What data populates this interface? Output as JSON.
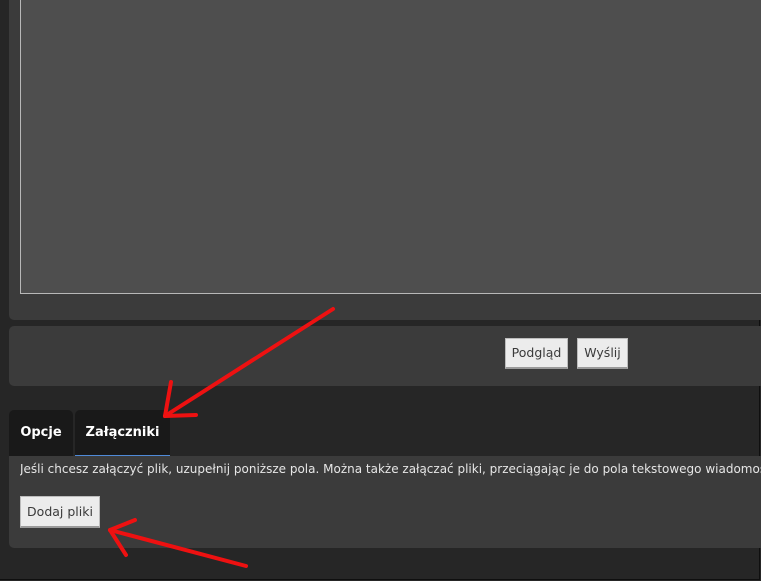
{
  "editor": {
    "message_value": ""
  },
  "submit_bar": {
    "preview_label": "Podgląd",
    "submit_label": "Wyślij"
  },
  "tabs": [
    {
      "label": "Opcje",
      "active": false
    },
    {
      "label": "Załączniki",
      "active": true
    }
  ],
  "attachments": {
    "instruction": "Jeśli chcesz załączyć plik, uzupełnij poniższe pola. Można także załączać pliki, przeciągając je do pola tekstowego wiadomości.",
    "add_files_label": "Dodaj pliki"
  },
  "colors": {
    "background": "#262626",
    "panel": "#3b3b3b",
    "textarea": "#4e4e4e",
    "tab": "#191919",
    "active_tab_underline": "#4f8ad8",
    "annotation_arrow": "#ee1111"
  }
}
